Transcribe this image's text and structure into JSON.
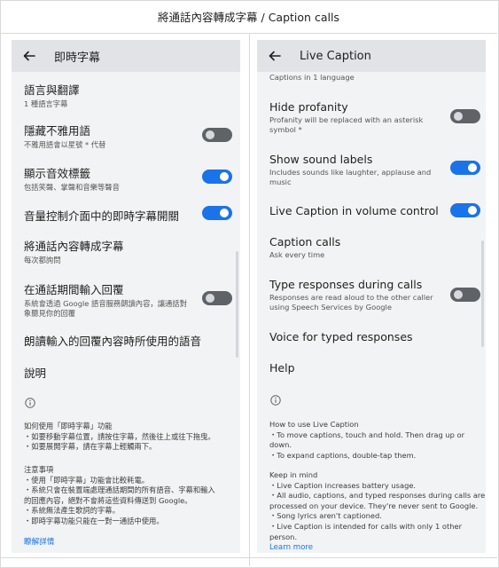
{
  "header": {
    "title": "將通話內容轉成字幕 / Caption calls"
  },
  "left": {
    "app_title": "即時字幕",
    "lang": {
      "title": "語言與翻譯",
      "sub": "1 種語言字幕"
    },
    "hide": {
      "title": "隱藏不雅用語",
      "sub": "不雅用語會以星號 * 代替",
      "state": "off"
    },
    "sound": {
      "title": "顯示音效標籤",
      "sub": "包括笑聲、掌聲和音樂等聲音",
      "state": "on"
    },
    "volume": {
      "title": "音量控制介面中的即時字幕開關",
      "state": "on"
    },
    "caption_calls": {
      "title": "將通話內容轉成字幕",
      "sub": "每次都詢問"
    },
    "type_resp": {
      "title": "在通話期間輸入回覆",
      "sub1": "系統會透過 Google 語音服務朗讀內容，讓通話對",
      "sub2": "象聽見你的回覆",
      "state": "off"
    },
    "voice": {
      "title": "朗讀輸入的回覆內容時所使用的語音"
    },
    "help": {
      "title": "說明"
    },
    "how": {
      "title": "如何使用「即時字幕」功能",
      "lines": [
        "・如要移動字幕位置，請按住字幕，然後往上或往下拖曳。",
        "・如要展開字幕，請在字幕上輕觸兩下。"
      ]
    },
    "keep": {
      "title": "注意事項",
      "lines": [
        "・使用「即時字幕」功能會比較耗電。",
        "・系統只會在裝置端處理通話期間的所有語音、字幕和輸入",
        "   的回應內容，絕對不會將這些資料傳送到 Google。",
        "・系統無法產生歌詞的字幕。",
        "・即時字幕功能只能在一對一通話中使用。"
      ]
    },
    "learn_more": "瞭解詳情"
  },
  "right": {
    "app_title": "Live Caption",
    "top_sub": "Captions in 1 language",
    "hide": {
      "title": "Hide profanity",
      "sub1": "Profanity will be replaced with an asterisk",
      "sub2": "symbol *",
      "state": "off"
    },
    "sound": {
      "title": "Show sound labels",
      "sub1": "Includes sounds like laughter, applause and",
      "sub2": "music",
      "state": "on"
    },
    "volume": {
      "title": "Live Caption in volume control",
      "state": "on"
    },
    "caption_calls": {
      "title": "Caption calls",
      "sub": "Ask every time"
    },
    "type_resp": {
      "title": "Type responses during calls",
      "sub1": "Responses are read aloud to the other caller",
      "sub2": "using Speech Services by Google",
      "state": "off"
    },
    "voice": {
      "title": "Voice for typed responses"
    },
    "help": {
      "title": "Help"
    },
    "how": {
      "title": "How to use Live Caption",
      "lines": [
        "・To move captions, touch and hold. Then drag up or",
        "   down.",
        "・To expand captions, double-tap them."
      ]
    },
    "keep": {
      "title": "Keep in mind",
      "lines": [
        "・Live Caption increases battery usage.",
        "・All audio, captions, and typed responses during calls are",
        "   processed on your device. They're never sent to Google.",
        "・Song lyrics aren't captioned.",
        "・Live Caption is intended for calls with only 1 other",
        "   person."
      ]
    },
    "learn_more": "Learn more"
  }
}
